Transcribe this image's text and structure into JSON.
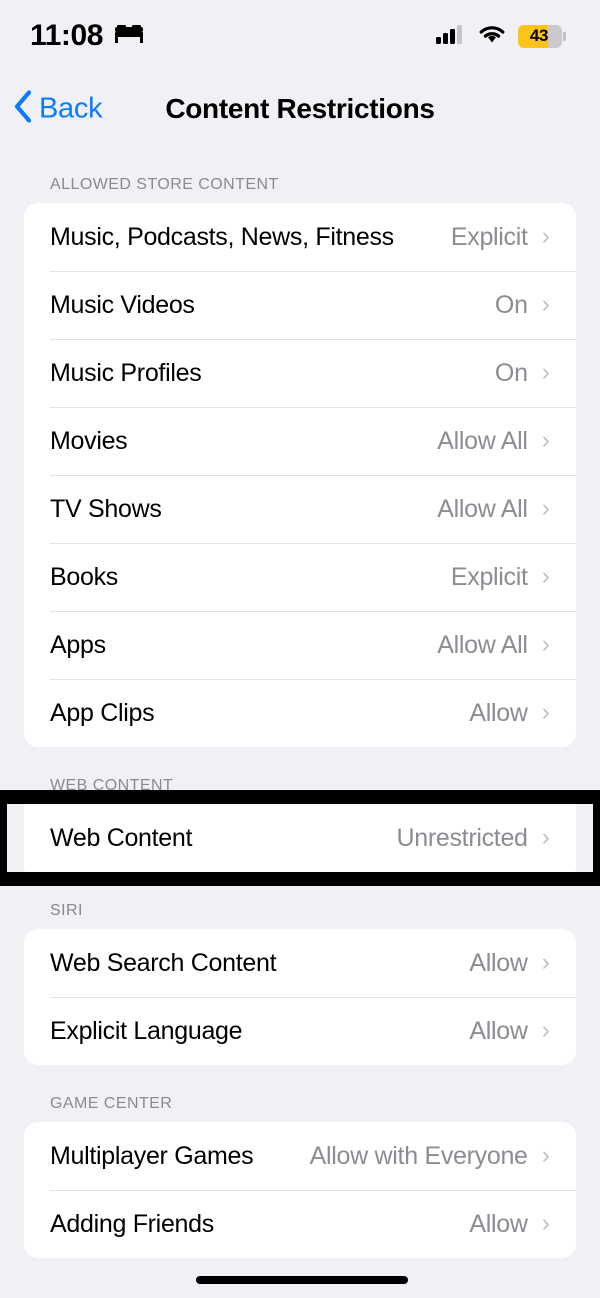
{
  "status_bar": {
    "time": "11:08",
    "focus_icon": "bed-icon",
    "cellular_icon": "cellular-bars-icon",
    "wifi_icon": "wifi-icon",
    "battery_percent": "43",
    "battery_color": "#fcc419"
  },
  "nav": {
    "back_label": "Back",
    "title": "Content Restrictions",
    "accent_color": "#0a7cff"
  },
  "sections": [
    {
      "header": "ALLOWED STORE CONTENT",
      "rows": [
        {
          "label": "Music, Podcasts, News, Fitness",
          "value": "Explicit"
        },
        {
          "label": "Music Videos",
          "value": "On"
        },
        {
          "label": "Music Profiles",
          "value": "On"
        },
        {
          "label": "Movies",
          "value": "Allow All"
        },
        {
          "label": "TV Shows",
          "value": "Allow All"
        },
        {
          "label": "Books",
          "value": "Explicit"
        },
        {
          "label": "Apps",
          "value": "Allow All"
        },
        {
          "label": "App Clips",
          "value": "Allow"
        }
      ]
    },
    {
      "header": "WEB CONTENT",
      "highlighted": true,
      "rows": [
        {
          "label": "Web Content",
          "value": "Unrestricted"
        }
      ]
    },
    {
      "header": "SIRI",
      "rows": [
        {
          "label": "Web Search Content",
          "value": "Allow"
        },
        {
          "label": "Explicit Language",
          "value": "Allow"
        }
      ]
    },
    {
      "header": "GAME CENTER",
      "rows": [
        {
          "label": "Multiplayer Games",
          "value": "Allow with Everyone"
        },
        {
          "label": "Adding Friends",
          "value": "Allow"
        }
      ]
    }
  ],
  "chevron_glyph": "›",
  "back_chevron_glyph": "‹",
  "colors": {
    "page_background": "#f0f0f5",
    "card_background": "#ffffff",
    "value_text": "#8c8c92",
    "header_text": "#8a8a90",
    "annotation": "#000000"
  }
}
